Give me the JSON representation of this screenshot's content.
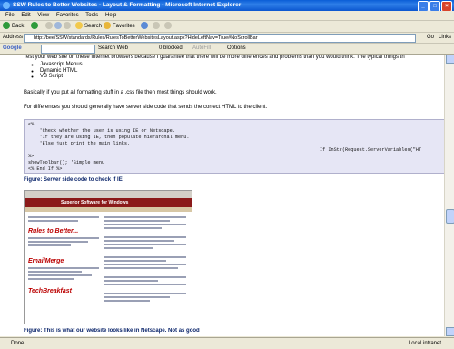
{
  "window": {
    "title": "SSW Rules to Better Websites - Layout & Formatting - Microsoft Internet Explorer"
  },
  "menu": [
    "File",
    "Edit",
    "View",
    "Favorites",
    "Tools",
    "Help"
  ],
  "toolbar": {
    "back": "Back",
    "search": "Search",
    "favorites": "Favorites"
  },
  "address": {
    "label": "Address",
    "url": "http://bee/SSW/standards/Rules/RulesToBetterWebsitesLayout.aspx?HideLeftNav=True#NoScrollBar",
    "go": "Go",
    "links": "Links"
  },
  "googlebar": {
    "label": "Google",
    "search_web": "Search Web",
    "blocked": "0 blocked",
    "autofill": "AutoFill",
    "options": "Options"
  },
  "content": {
    "intro": "Test your web site on these Internet browsers because I guarantee that there will be more differences and problems than you would think. The typical things th",
    "list": [
      "Javascript Menus",
      "Dynamic HTML",
      "VB Script"
    ],
    "para2": "Basically if you put all formatting stuff in a .css file then most things should work.",
    "para3": "For differences you should generally have server side code that sends the correct HTML to the client.",
    "code": [
      "<%",
      "    'Check whether the user is using IE or Netscape.",
      "    'If they are using IE, then populate hierarchal menu.",
      "    'Else just print the main links.",
      "If InStr(Request.ServerVariables(\"HT",
      "%>",
      "showToolbar(); 'Simple menu",
      "<% End If %>"
    ],
    "figure1": "Figure: Server side code to check if IE",
    "figure2": "Figure: This is what our website looks like in Netscape. Not as good"
  },
  "screenshot": {
    "banner": "Superior Software for Windows",
    "logo1": "Rules to Better...",
    "logo2": "EmailMerge",
    "logo3": "TechBreakfast"
  },
  "status": {
    "left": "Done",
    "zone": "Local intranet"
  }
}
